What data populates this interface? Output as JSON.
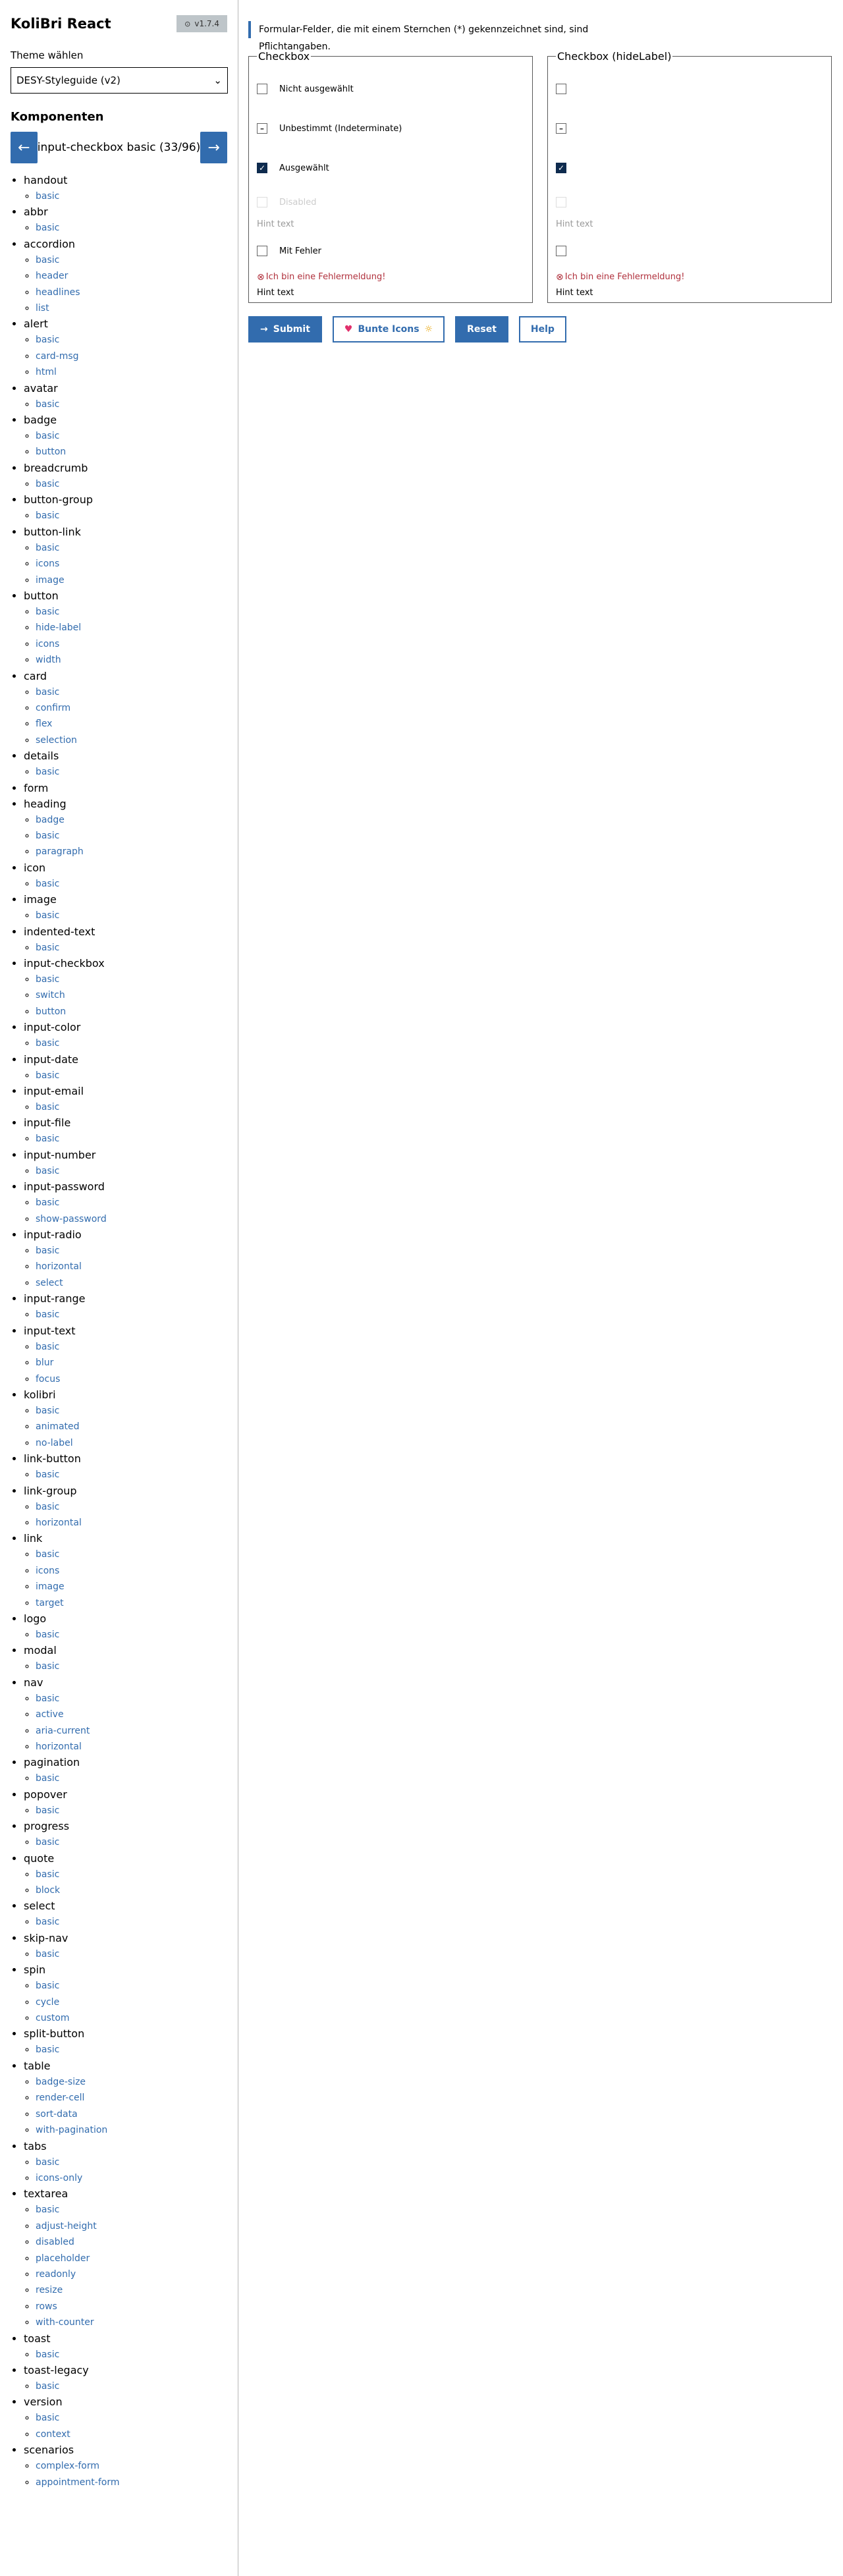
{
  "app": {
    "title": "KoliBri React",
    "version": "v1.7.4",
    "version_icon": "github-icon"
  },
  "theme": {
    "label": "Theme wählen",
    "selected": "DESY-Styleguide (v2)"
  },
  "components": {
    "heading": "Komponenten",
    "current": "input-checkbox basic (33/96)",
    "prev_icon": "←",
    "next_icon": "→"
  },
  "tree": [
    {
      "name": "handout",
      "children": [
        "basic"
      ]
    },
    {
      "name": "abbr",
      "children": [
        "basic"
      ]
    },
    {
      "name": "accordion",
      "children": [
        "basic",
        "header",
        "headlines",
        "list"
      ]
    },
    {
      "name": "alert",
      "children": [
        "basic",
        "card-msg",
        "html"
      ]
    },
    {
      "name": "avatar",
      "children": [
        "basic"
      ]
    },
    {
      "name": "badge",
      "children": [
        "basic",
        "button"
      ]
    },
    {
      "name": "breadcrumb",
      "children": [
        "basic"
      ]
    },
    {
      "name": "button-group",
      "children": [
        "basic"
      ]
    },
    {
      "name": "button-link",
      "children": [
        "basic",
        "icons",
        "image"
      ]
    },
    {
      "name": "button",
      "children": [
        "basic",
        "hide-label",
        "icons",
        "width"
      ]
    },
    {
      "name": "card",
      "children": [
        "basic",
        "confirm",
        "flex",
        "selection"
      ]
    },
    {
      "name": "details",
      "children": [
        "basic"
      ]
    },
    {
      "name": "form",
      "children": []
    },
    {
      "name": "heading",
      "children": [
        "badge",
        "basic",
        "paragraph"
      ]
    },
    {
      "name": "icon",
      "children": [
        "basic"
      ]
    },
    {
      "name": "image",
      "children": [
        "basic"
      ]
    },
    {
      "name": "indented-text",
      "children": [
        "basic"
      ]
    },
    {
      "name": "input-checkbox",
      "children": [
        "basic",
        "switch",
        "button"
      ]
    },
    {
      "name": "input-color",
      "children": [
        "basic"
      ]
    },
    {
      "name": "input-date",
      "children": [
        "basic"
      ]
    },
    {
      "name": "input-email",
      "children": [
        "basic"
      ]
    },
    {
      "name": "input-file",
      "children": [
        "basic"
      ]
    },
    {
      "name": "input-number",
      "children": [
        "basic"
      ]
    },
    {
      "name": "input-password",
      "children": [
        "basic",
        "show-password"
      ]
    },
    {
      "name": "input-radio",
      "children": [
        "basic",
        "horizontal",
        "select"
      ]
    },
    {
      "name": "input-range",
      "children": [
        "basic"
      ]
    },
    {
      "name": "input-text",
      "children": [
        "basic",
        "blur",
        "focus"
      ]
    },
    {
      "name": "kolibri",
      "children": [
        "basic",
        "animated",
        "no-label"
      ]
    },
    {
      "name": "link-button",
      "children": [
        "basic"
      ]
    },
    {
      "name": "link-group",
      "children": [
        "basic",
        "horizontal"
      ]
    },
    {
      "name": "link",
      "children": [
        "basic",
        "icons",
        "image",
        "target"
      ]
    },
    {
      "name": "logo",
      "children": [
        "basic"
      ]
    },
    {
      "name": "modal",
      "children": [
        "basic"
      ]
    },
    {
      "name": "nav",
      "children": [
        "basic",
        "active",
        "aria-current",
        "horizontal"
      ]
    },
    {
      "name": "pagination",
      "children": [
        "basic"
      ]
    },
    {
      "name": "popover",
      "children": [
        "basic"
      ]
    },
    {
      "name": "progress",
      "children": [
        "basic"
      ]
    },
    {
      "name": "quote",
      "children": [
        "basic",
        "block"
      ]
    },
    {
      "name": "select",
      "children": [
        "basic"
      ]
    },
    {
      "name": "skip-nav",
      "children": [
        "basic"
      ]
    },
    {
      "name": "spin",
      "children": [
        "basic",
        "cycle",
        "custom"
      ]
    },
    {
      "name": "split-button",
      "children": [
        "basic"
      ]
    },
    {
      "name": "table",
      "children": [
        "badge-size",
        "render-cell",
        "sort-data",
        "with-pagination"
      ]
    },
    {
      "name": "tabs",
      "children": [
        "basic",
        "icons-only"
      ]
    },
    {
      "name": "textarea",
      "children": [
        "basic",
        "adjust-height",
        "disabled",
        "placeholder",
        "readonly",
        "resize",
        "rows",
        "with-counter"
      ]
    },
    {
      "name": "toast",
      "children": [
        "basic"
      ]
    },
    {
      "name": "toast-legacy",
      "children": [
        "basic"
      ]
    },
    {
      "name": "version",
      "children": [
        "basic",
        "context"
      ]
    },
    {
      "name": "scenarios",
      "children": [
        "complex-form",
        "appointment-form"
      ]
    }
  ],
  "main": {
    "notice": "Formular-Felder, die mit einem Sternchen (*) gekennzeichnet sind, sind Pflichtangaben.",
    "fieldset1": {
      "legend": "Checkbox",
      "unchecked": "Nicht ausgewählt",
      "indeterminate": "Unbestimmt (Indeterminate)",
      "checked": "Ausgewählt",
      "disabled": "Disabled",
      "hint": "Hint text",
      "error_label": "Mit Fehler",
      "error_msg": "Ich bin eine Fehlermeldung!",
      "hint2": "Hint text"
    },
    "fieldset2": {
      "legend": "Checkbox (hideLabel)",
      "hint": "Hint text",
      "error_msg": "Ich bin eine Fehlermeldung!",
      "hint2": "Hint text"
    },
    "buttons": {
      "submit": "Submit",
      "submit_icon": "→",
      "colorful": "Bunte Icons",
      "colorful_icon_left": "♥",
      "colorful_icon_right": "☼",
      "reset": "Reset",
      "help": "Help"
    }
  }
}
